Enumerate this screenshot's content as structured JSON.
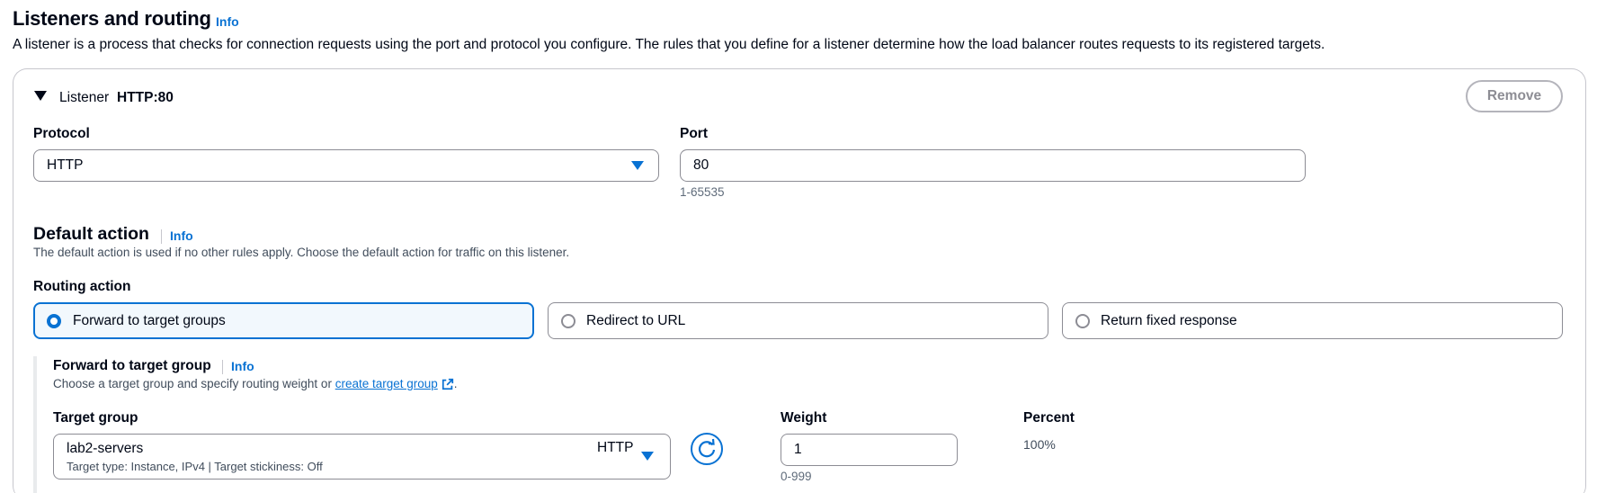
{
  "section": {
    "title": "Listeners and routing",
    "info": "Info",
    "description": "A listener is a process that checks for connection requests using the port and protocol you configure. The rules that you define for a listener determine how the load balancer routes requests to its registered targets."
  },
  "listener": {
    "label": "Listener",
    "value": "HTTP:80",
    "remove_label": "Remove",
    "protocol": {
      "label": "Protocol",
      "value": "HTTP"
    },
    "port": {
      "label": "Port",
      "value": "80",
      "hint": "1-65535"
    }
  },
  "default_action": {
    "title": "Default action",
    "info": "Info",
    "description": "The default action is used if no other rules apply. Choose the default action for traffic on this listener.",
    "routing_label": "Routing action",
    "options": [
      {
        "label": "Forward to target groups",
        "selected": true
      },
      {
        "label": "Redirect to URL",
        "selected": false
      },
      {
        "label": "Return fixed response",
        "selected": false
      }
    ]
  },
  "forward": {
    "title": "Forward to target group",
    "info": "Info",
    "description_prefix": "Choose a target group and specify routing weight or ",
    "create_link": "create target group",
    "description_suffix": ".",
    "target_group": {
      "label": "Target group",
      "name": "lab2-servers",
      "meta": "Target type: Instance, IPv4 | Target stickiness: Off",
      "protocol": "HTTP"
    },
    "weight": {
      "label": "Weight",
      "value": "1",
      "hint": "0-999"
    },
    "percent": {
      "label": "Percent",
      "value": "100%"
    }
  },
  "colors": {
    "accent": "#0972d3",
    "text": "#000716",
    "border": "#8c8c94",
    "selected_bg": "#f2f8fd"
  }
}
